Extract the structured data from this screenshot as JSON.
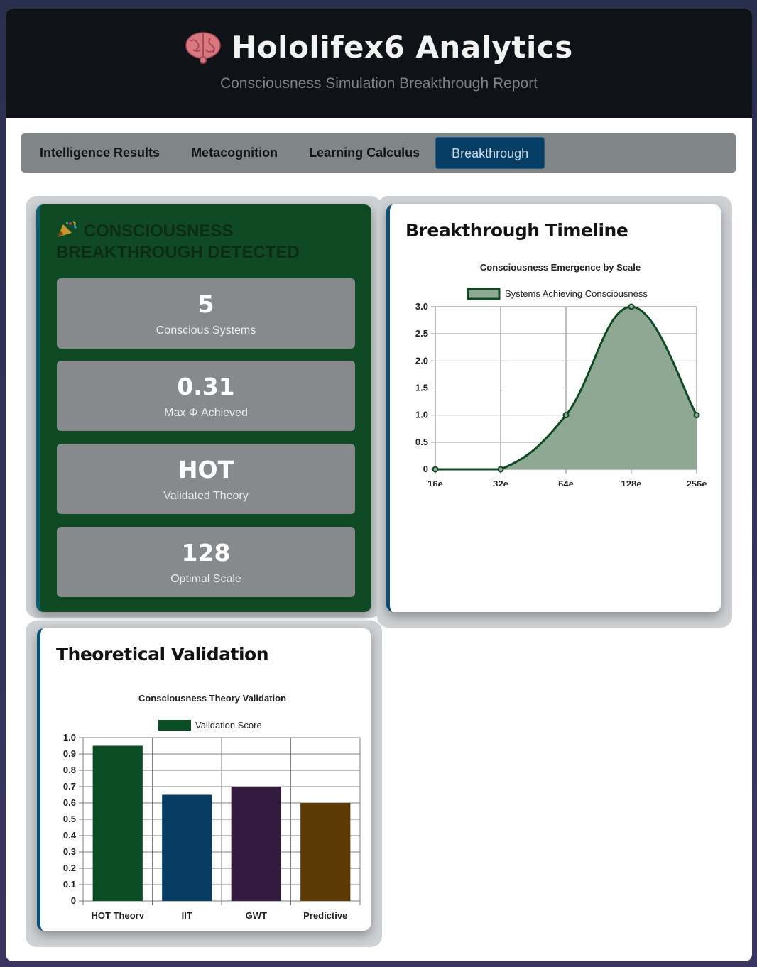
{
  "header": {
    "brain_icon": "brain-icon",
    "title": "Hololifex6 Analytics",
    "subtitle": "Consciousness Simulation Breakthrough Report"
  },
  "tabs": [
    {
      "label": "Intelligence Results",
      "active": false
    },
    {
      "label": "Metacognition",
      "active": false
    },
    {
      "label": "Learning Calculus",
      "active": false
    },
    {
      "label": "Breakthrough",
      "active": true
    }
  ],
  "breakthrough": {
    "icon": "party-popper-icon",
    "heading": "Consciousness Breakthrough Detected",
    "metrics": [
      {
        "value": "5",
        "label": "Conscious Systems"
      },
      {
        "value": "0.31",
        "label": "Max Φ Achieved"
      },
      {
        "value": "HOT",
        "label": "Validated Theory"
      },
      {
        "value": "128",
        "label": "Optimal Scale"
      }
    ]
  },
  "timeline": {
    "title": "Breakthrough Timeline"
  },
  "validation": {
    "title": "Theoretical Validation"
  },
  "colors": {
    "header_bg": "#0f1318",
    "tab_active": "#063e66",
    "green_card": "#0f4a24",
    "line_stroke": "#0e4a23",
    "area_fill": "#8fa893"
  },
  "chart_data": [
    {
      "type": "area",
      "title": "Consciousness Emergence by Scale",
      "categories": [
        "16e",
        "32e",
        "64e",
        "128e",
        "256e"
      ],
      "series": [
        {
          "name": "Systems Achieving Consciousness",
          "values": [
            0,
            0,
            1,
            3,
            1
          ],
          "color": "#0e4a23",
          "fill": "#8fa893"
        }
      ],
      "yticks": [
        "0",
        "0.5",
        "1.0",
        "1.5",
        "2.0",
        "2.5",
        "3.0"
      ],
      "ylim": [
        0,
        3
      ],
      "grid": true,
      "legend": "top"
    },
    {
      "type": "bar",
      "title": "Consciousness Theory Validation",
      "categories": [
        "HOT Theory",
        "IIT",
        "GWT",
        "Predictive"
      ],
      "series": [
        {
          "name": "Validation Score",
          "values": [
            0.95,
            0.65,
            0.7,
            0.6
          ]
        }
      ],
      "bar_colors": [
        "#0b4d24",
        "#083d63",
        "#331b40",
        "#5b3a05"
      ],
      "yticks": [
        "0",
        "0.1",
        "0.2",
        "0.3",
        "0.4",
        "0.5",
        "0.6",
        "0.7",
        "0.8",
        "0.9",
        "1.0"
      ],
      "ylim": [
        0,
        1
      ],
      "grid": true,
      "legend": "top"
    }
  ]
}
